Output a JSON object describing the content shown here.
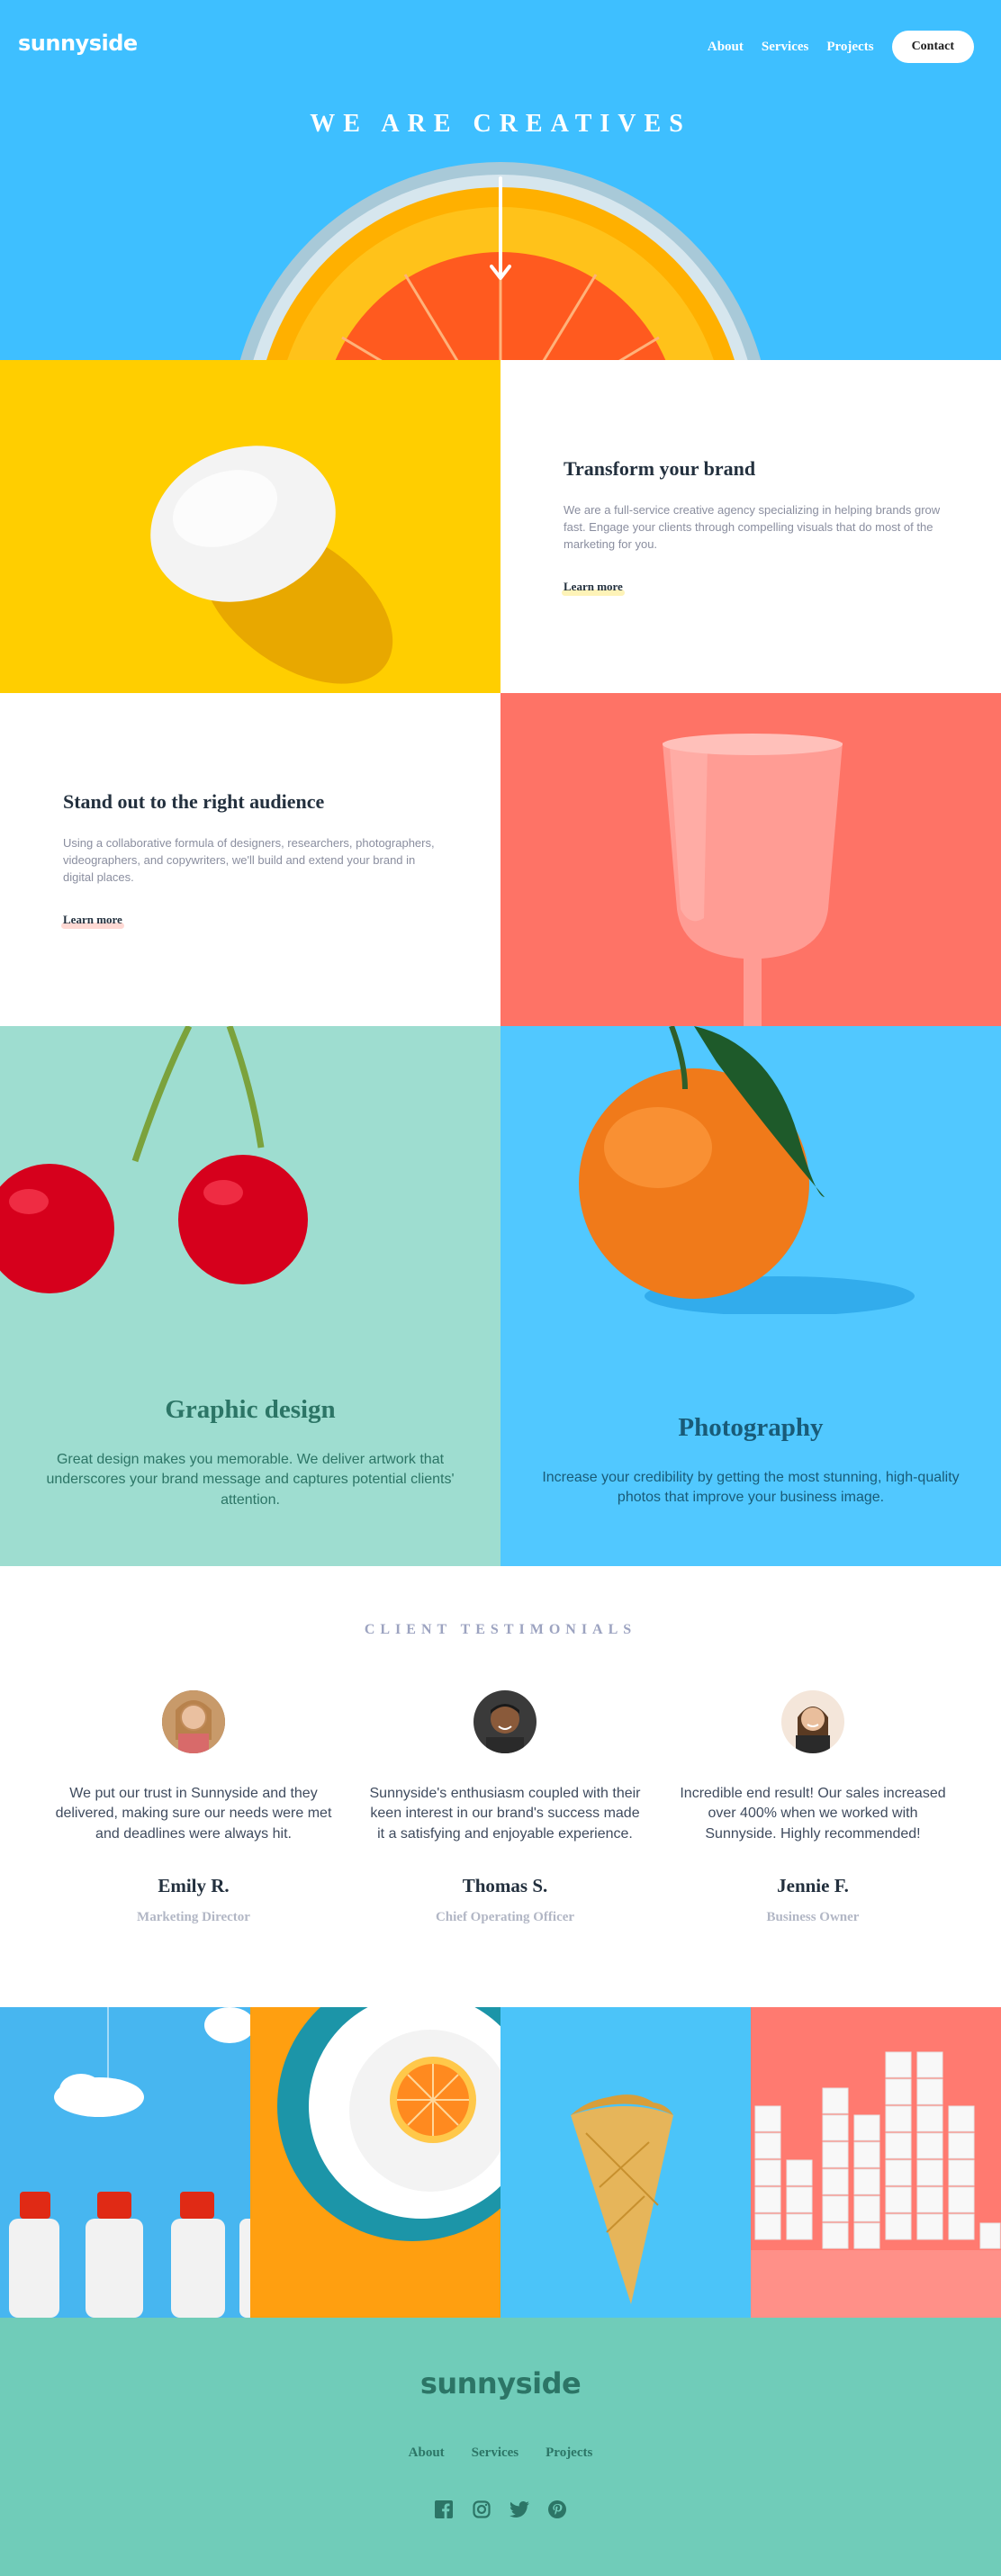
{
  "header": {
    "logo": "sunnyside",
    "nav": [
      "About",
      "Services",
      "Projects"
    ],
    "contact": "Contact"
  },
  "hero": {
    "title": "WE ARE CREATIVES",
    "arrow_icon": "arrow-down-icon"
  },
  "features": [
    {
      "title": "Transform your brand",
      "body": "We are a full-service creative agency specializing in helping brands grow fast. Engage your clients through compelling visuals that do most of the marketing for you.",
      "link": "Learn more",
      "underline_color": "#FAD400"
    },
    {
      "title": "Stand out to the right audience",
      "body": "Using a collaborative formula of designers, researchers, photographers, videographers, and copywriters, we'll build and extend your brand in digital places.",
      "link": "Learn more",
      "underline_color": "#FE7566"
    }
  ],
  "services": [
    {
      "title": "Graphic design",
      "body": "Great design makes you memorable. We deliver artwork that underscores your brand message and captures potential clients' attention.",
      "color": "#2C7566"
    },
    {
      "title": "Photography",
      "body": "Increase your credibility by getting the most stunning, high-quality photos that improve your business image.",
      "color": "#195B78"
    }
  ],
  "testimonials": {
    "title": "CLIENT TESTIMONIALS",
    "items": [
      {
        "quote": "We put our trust in Sunnyside and they delivered, making sure our needs were met and deadlines were always hit.",
        "name": "Emily R.",
        "role": "Marketing Director"
      },
      {
        "quote": "Sunnyside's enthusiasm coupled with their keen interest in our brand's success made it a satisfying and enjoyable experience.",
        "name": "Thomas S.",
        "role": "Chief Operating Officer"
      },
      {
        "quote": "Incredible end result! Our sales increased over 400% when we worked with Sunnyside. Highly recommended!",
        "name": "Jennie F.",
        "role": "Business Owner"
      }
    ]
  },
  "footer": {
    "logo": "sunnyside",
    "nav": [
      "About",
      "Services",
      "Projects"
    ],
    "social": [
      "facebook-icon",
      "instagram-icon",
      "twitter-icon",
      "pinterest-icon"
    ]
  },
  "colors": {
    "hero_blue": "#3EBFFF",
    "yellow": "#FFCE00",
    "coral": "#FE7366",
    "mint": "#9EDDD0",
    "footer_green": "#70CCB9"
  }
}
